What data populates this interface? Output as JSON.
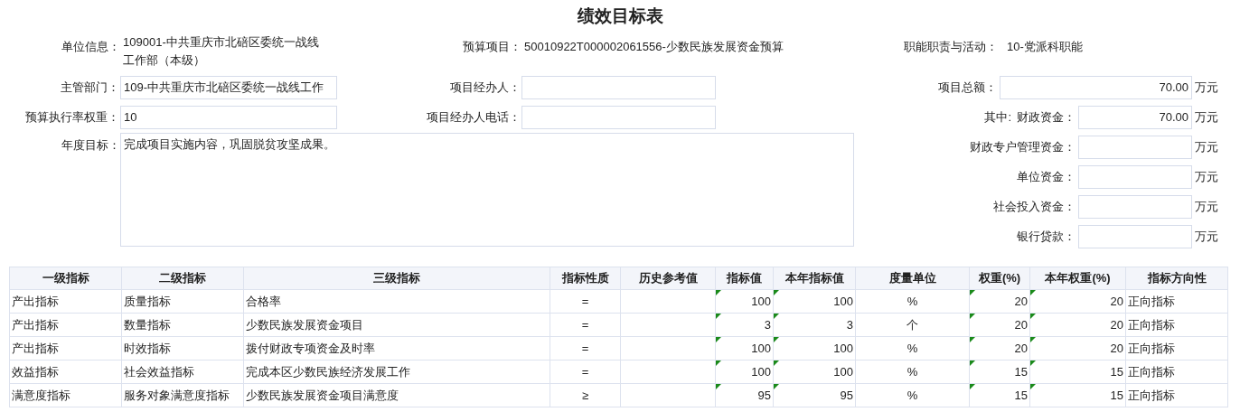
{
  "title": "绩效目标表",
  "info": [
    {
      "label": "单位信息：",
      "value": "109001-中共重庆市北碚区委统一战线工作部（本级）"
    },
    {
      "label": "预算项目：",
      "value": "50010922T000002061556-少数民族发展资金预算"
    },
    {
      "label": "职能职责与活动：",
      "value": "10-党派科职能"
    }
  ],
  "left_fields": [
    {
      "label": "主管部门：",
      "value": "109-中共重庆市北碚区委统一战线工作"
    },
    {
      "label": "项目经办人："
    },
    {
      "label": "预算执行率权重：",
      "value": "10"
    },
    {
      "label": "项目经办人电话："
    }
  ],
  "annual_goal": {
    "label": "年度目标：",
    "value": "完成项目实施内容，巩固脱贫攻坚成果。"
  },
  "funds": [
    {
      "kind": "total",
      "label": "项目总额：",
      "value": "70.00",
      "unit": "万元"
    },
    {
      "kind": "part",
      "prefix": "其中:",
      "label": "财政资金：",
      "value": "70.00",
      "unit": "万元"
    },
    {
      "kind": "part",
      "label": "财政专户管理资金：",
      "unit": "万元"
    },
    {
      "kind": "part",
      "label": "单位资金：",
      "unit": "万元"
    },
    {
      "kind": "part",
      "label": "社会投入资金：",
      "unit": "万元"
    },
    {
      "kind": "part",
      "label": "银行贷款：",
      "unit": "万元"
    }
  ],
  "table": {
    "columns": [
      {
        "label": "一级指标",
        "marked": false
      },
      {
        "label": "二级指标",
        "marked": false
      },
      {
        "label": "三级指标",
        "marked": false
      },
      {
        "label": "指标性质",
        "marked": false
      },
      {
        "label": "历史参考值",
        "marked": false
      },
      {
        "label": "指标值",
        "marked": true
      },
      {
        "label": "本年指标值",
        "marked": true
      },
      {
        "label": "度量单位",
        "marked": false
      },
      {
        "label": "权重(%)",
        "marked": true
      },
      {
        "label": "本年权重(%)",
        "marked": true
      },
      {
        "label": "指标方向性",
        "marked": false
      }
    ],
    "rows": [
      [
        "产出指标",
        "质量指标",
        "合格率",
        "=",
        null,
        "100",
        "100",
        "%",
        "20",
        "20",
        "正向指标"
      ],
      [
        "产出指标",
        "数量指标",
        "少数民族发展资金项目",
        "=",
        null,
        "3",
        "3",
        "个",
        "20",
        "20",
        "正向指标"
      ],
      [
        "产出指标",
        "时效指标",
        "拨付财政专项资金及时率",
        "=",
        null,
        "100",
        "100",
        "%",
        "20",
        "20",
        "正向指标"
      ],
      [
        "效益指标",
        "社会效益指标",
        "完成本区少数民族经济发展工作",
        "=",
        null,
        "100",
        "100",
        "%",
        "15",
        "15",
        "正向指标"
      ],
      [
        "满意度指标",
        "服务对象满意度指标",
        "少数民族发展资金项目满意度",
        "≥",
        null,
        "95",
        "95",
        "%",
        "15",
        "15",
        "正向指标"
      ]
    ]
  }
}
